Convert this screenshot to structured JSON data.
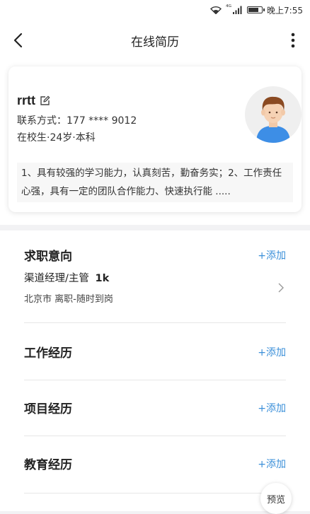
{
  "status_bar": {
    "network": "⁴ᴳ",
    "time": "晚上7:55"
  },
  "nav": {
    "title": "在线简历",
    "back_icon": "back-arrow-icon",
    "more_icon": "more-vertical-icon"
  },
  "profile": {
    "name": "rrtt",
    "contact": "联系方式：177 **** 9012",
    "meta": "在校生·24岁·本科",
    "summary": "1、具有较强的学习能力，认真刻苦，勤奋务实；2、工作责任心强，具有一定的团队合作能力、快速执行能 .....",
    "avatar_icon": "avatar-boy-icon"
  },
  "sections": {
    "job_intention": {
      "title": "求职意向",
      "add_label": "+添加",
      "position": "渠道经理/主管",
      "salary": "1k",
      "location_status": "北京市 离职-随时到岗"
    },
    "work": {
      "title": "工作经历",
      "add_label": "+添加"
    },
    "project": {
      "title": "项目经历",
      "add_label": "+添加"
    },
    "education": {
      "title": "教育经历",
      "add_label": "+添加"
    }
  },
  "preview_label": "预览",
  "colors": {
    "accent": "#3a8fd9",
    "background": "#f2f2f4"
  },
  "battery_level": 0.8
}
